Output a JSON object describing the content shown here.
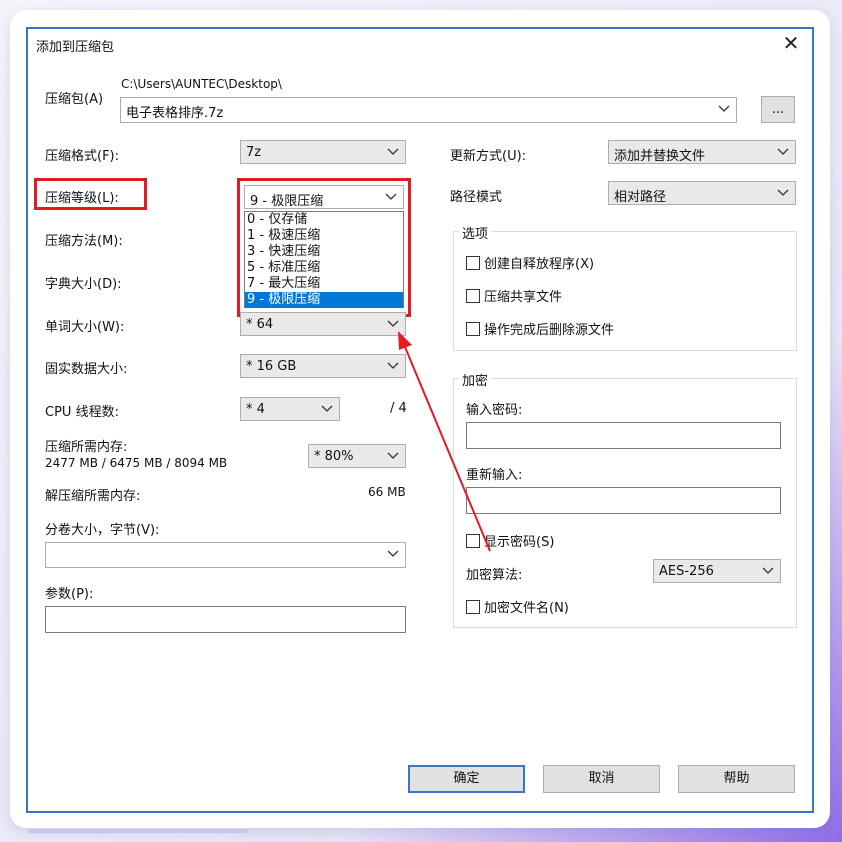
{
  "dialog": {
    "title": "添加到压缩包",
    "close_glyph": "✕"
  },
  "archive": {
    "label": "压缩包(A)",
    "path": "C:\\Users\\AUNTEC\\Desktop\\",
    "filename": "电子表格排序.7z",
    "browse_label": "..."
  },
  "left": {
    "format_label": "压缩格式(F):",
    "format_value": "7z",
    "level_label": "压缩等级(L):",
    "level_value": "9 - 极限压缩",
    "level_options": [
      "0 - 仅存储",
      "1 - 极速压缩",
      "3 - 快速压缩",
      "5 - 标准压缩",
      "7 - 最大压缩",
      "9 - 极限压缩"
    ],
    "level_selected_index": 5,
    "method_label": "压缩方法(M):",
    "dict_label": "字典大小(D):",
    "word_label": "单词大小(W):",
    "word_value": "* 64",
    "solid_label": "固实数据大小:",
    "solid_value": "* 16 GB",
    "cpu_label": "CPU 线程数:",
    "cpu_value": "* 4",
    "cpu_total": "/ 4",
    "mem_label": "压缩所需内存:",
    "mem_value": "2477 MB / 6475 MB / 8094 MB",
    "mem_percent": "* 80%",
    "decomp_label": "解压缩所需内存:",
    "decomp_value": "66 MB",
    "split_label": "分卷大小，字节(V):",
    "params_label": "参数(P):"
  },
  "right": {
    "update_label": "更新方式(U):",
    "update_value": "添加并替换文件",
    "path_label": "路径模式",
    "path_value": "相对路径",
    "options_title": "选项",
    "options": [
      "创建自释放程序(X)",
      "压缩共享文件",
      "操作完成后删除源文件"
    ],
    "encrypt_title": "加密",
    "pwd_label": "输入密码:",
    "pwd2_label": "重新输入:",
    "show_pwd": "显示密码(S)",
    "algo_label": "加密算法:",
    "algo_value": "AES-256",
    "encrypt_names": "加密文件名(N)"
  },
  "buttons": {
    "ok": "确定",
    "cancel": "取消",
    "help": "帮助"
  },
  "colors": {
    "highlight_red": "#e01b24",
    "selection_blue": "#0078d7",
    "dialog_border": "#3a76c4"
  }
}
